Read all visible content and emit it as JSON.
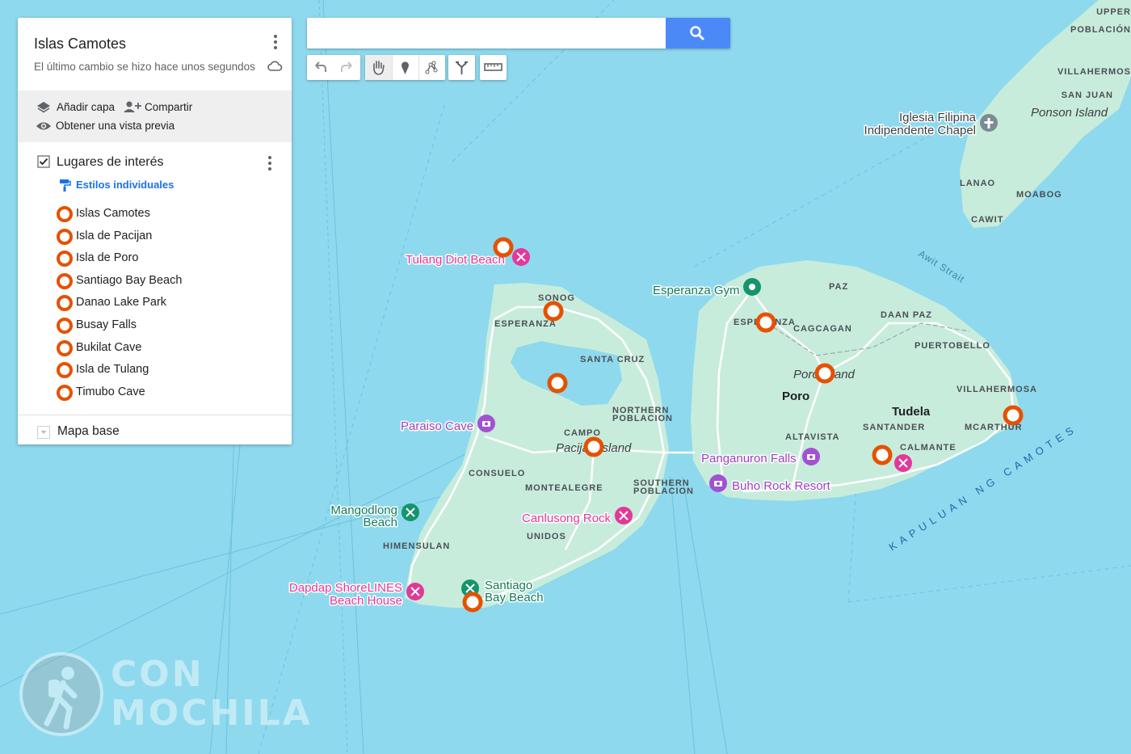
{
  "map": {
    "colors": {
      "water": "#8ed9ee",
      "land": "#c8ecdb",
      "marker": "#e65100",
      "road": "#ffffff"
    },
    "place_labels": {
      "camotes_island_chapel": "Iglesia Filipina\nIndipendente Chapel",
      "ponson_island": "Ponson Island",
      "pilar_poblacion": "POBLACIÓN",
      "pilar_upper": "UPPER",
      "villahermosa_n": "VILLAHERMOS",
      "san_juan": "SAN JUAN",
      "lanao": "LANAO",
      "moabog": "MOABOG",
      "cawit": "CAWIT",
      "awit_strait": "Awit Strait",
      "tulang_diot_beach": "Tulang Diot Beach",
      "esperanza_gym": "Esperanza Gym",
      "sonog": "SONOG",
      "esperanza_w": "ESPERANZA",
      "santa_cruz": "SANTA CRUZ",
      "northern_poblacion_1": "NORTHERN",
      "northern_poblacion_2": "POBLACION",
      "paraiso_cave": "Paraiso Cave",
      "campo": "CAMPO",
      "pacijan_island": "Pacijan Island",
      "consuelo": "CONSUELO",
      "montealegre": "MONTEALEGRE",
      "southern_poblacion_1": "SOUTHERN",
      "southern_poblacion_2": "POBLACION",
      "mangodlong_beach_1": "Mangodlong",
      "mangodlong_beach_2": "Beach",
      "canlusong_rock": "Canlusong Rock",
      "unidos": "UNIDOS",
      "himensulan": "HIMENSULAN",
      "dapdap_1": "Dapdap ShoreLINES",
      "dapdap_2": "Beach House",
      "santiago_1": "Santiago",
      "santiago_2": "Bay Beach",
      "paz": "PAZ",
      "daan_paz": "DAAN PAZ",
      "esperanza_e": "ESPERANZA",
      "cagcagan": "CAGCAGAN",
      "puertobello": "PUERTOBELLO",
      "poro_island": "Poro Island",
      "poro": "Poro",
      "villahermosa": "VILLAHERMOSA",
      "tudela": "Tudela",
      "santander": "SANTANDER",
      "altavista": "ALTAVISTA",
      "mcarthur": "MCARTHUR",
      "calmante": "CALMANTE",
      "panganuron_falls": "Panganuron Falls",
      "buho_rock_resort": "Buho Rock Resort",
      "kapuluan": "KAPULUAN NG CAMOTES"
    }
  },
  "panel": {
    "title": "Islas Camotes",
    "subtitle": "El último cambio se hizo hace unos segundos",
    "add_layer": "Añadir capa",
    "share": "Compartir",
    "preview": "Obtener una vista previa",
    "layer_name": "Lugares de interés",
    "styles_link": "Estilos individuales",
    "items": [
      "Islas Camotes",
      "Isla de Pacijan",
      "Isla de Poro",
      "Santiago Bay Beach",
      "Danao Lake Park",
      "Busay Falls",
      "Bukilat Cave",
      "Isla de Tulang",
      "Timubo Cave"
    ],
    "base_map": "Mapa base"
  },
  "search": {
    "value": "",
    "placeholder": ""
  },
  "toolbar": {
    "undo_icon": "undo-icon",
    "redo_icon": "redo-icon",
    "pan_icon": "hand-icon",
    "marker_icon": "marker-icon",
    "line_icon": "draw-line-icon",
    "directions_icon": "directions-icon",
    "measure_icon": "ruler-icon"
  },
  "watermark": {
    "line1": "CON",
    "line2": "MOCHILA"
  }
}
